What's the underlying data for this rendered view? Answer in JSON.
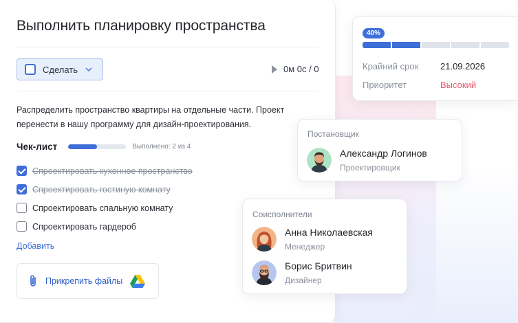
{
  "task": {
    "title": "Выполнить планировку пространства",
    "status_label": "Сделать",
    "timer": "0м 0с / 0",
    "description": "Распределить пространство квартиры на отдельные части. Проект перенести в нашу программу для дизайн-проектирования.",
    "checklist": {
      "title": "Чек-лист",
      "progress": 0.5,
      "done_text": "Выполнено: 2 из 4",
      "items": [
        {
          "label": "Спроектировать кухонное пространство",
          "checked": true
        },
        {
          "label": "Спроектировать гостиную комнату",
          "checked": true
        },
        {
          "label": "Спроектировать спальную комнату",
          "checked": false
        },
        {
          "label": "Спроектировать гардероб",
          "checked": false
        }
      ],
      "add_label": "Добавить"
    },
    "attach_label": "Прикрепить файлы"
  },
  "meta": {
    "progress_label": "40%",
    "progress": 0.4,
    "deadline_label": "Крайний срок",
    "deadline_value": "21.09.2026",
    "priority_label": "Приоритет",
    "priority_value": "Высокий"
  },
  "setter": {
    "caption": "Постановщик",
    "name": "Александр Логинов",
    "role": "Проектировщик"
  },
  "coexecutors": {
    "caption": "Соисполнители",
    "people": [
      {
        "name": "Анна Николаевская",
        "role": "Менеджер"
      },
      {
        "name": "Борис Бритвин",
        "role": "Дизайнер"
      }
    ]
  },
  "colors": {
    "accent": "#3e6fd8",
    "priority_high": "#e35b6a",
    "muted_text": "#8b919b"
  },
  "icons": {
    "status": "checkbox-icon",
    "dropdown": "chevron-down-icon",
    "timer": "play-icon",
    "attach": "paperclip-icon",
    "drive": "google-drive-icon"
  }
}
